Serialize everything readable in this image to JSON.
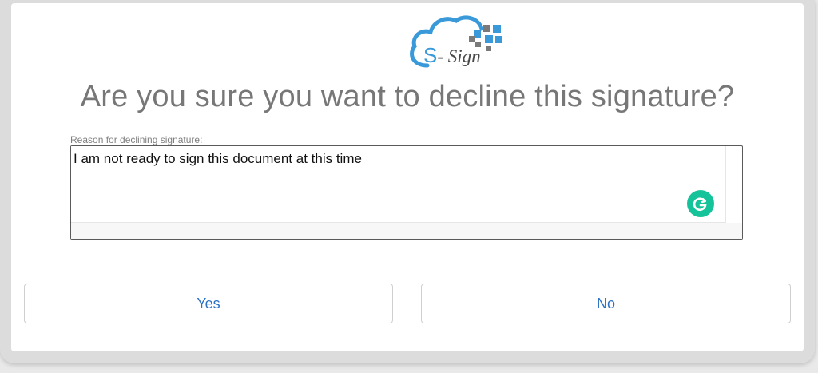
{
  "logo": {
    "brand_text": "S-Sign",
    "brand_prefix": "S",
    "brand_suffix": "- Sign"
  },
  "dialog": {
    "title": "Are you sure you want to decline this signature?",
    "reason_label": "Reason for declining signature:",
    "reason_value": "I am not ready to sign this document at this time",
    "yes_label": "Yes",
    "no_label": "No"
  },
  "colors": {
    "accent_blue": "#2d72c4",
    "logo_blue": "#3a9ad9",
    "grammarly_green": "#15c39a",
    "title_gray": "#777777"
  },
  "icons": {
    "logo": "s-sign-cloud-logo",
    "grammarly": "grammarly-icon"
  }
}
